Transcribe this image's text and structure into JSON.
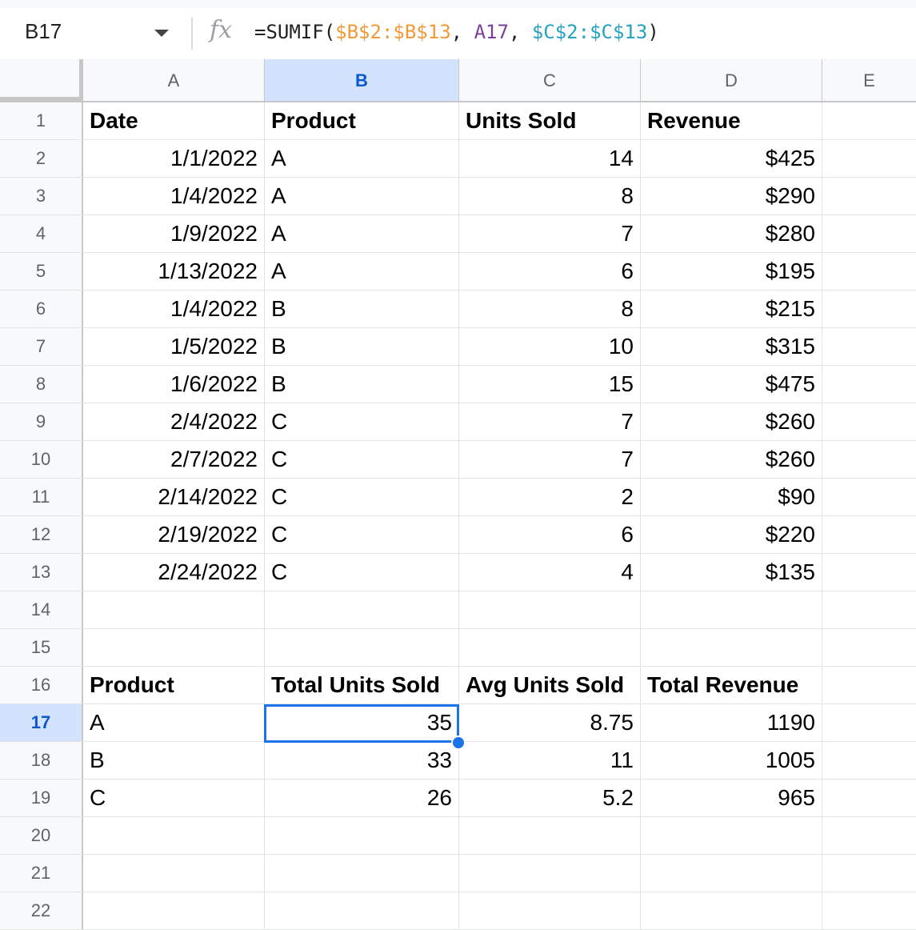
{
  "formula_bar": {
    "name_box": "B17",
    "fx_icon": "fx",
    "formula": [
      {
        "text": "=SUMIF(",
        "color": "#202124"
      },
      {
        "text": "$B$2:$B$13",
        "color": "#f29a38"
      },
      {
        "text": ", ",
        "color": "#202124"
      },
      {
        "text": "A17",
        "color": "#7b3f9e"
      },
      {
        "text": ", ",
        "color": "#202124"
      },
      {
        "text": "$C$2:$C$13",
        "color": "#23a2c2"
      },
      {
        "text": ")",
        "color": "#202124"
      }
    ]
  },
  "columns": [
    "A",
    "B",
    "C",
    "D",
    "E"
  ],
  "selected_column": "B",
  "selected_row": "17",
  "rows": [
    {
      "n": "1",
      "cells": [
        "Date",
        "Product",
        "Units Sold",
        "Revenue"
      ],
      "bold": true
    },
    {
      "n": "2",
      "cells": [
        "1/1/2022",
        "A",
        "14",
        "$425"
      ]
    },
    {
      "n": "3",
      "cells": [
        "1/4/2022",
        "A",
        "8",
        "$290"
      ]
    },
    {
      "n": "4",
      "cells": [
        "1/9/2022",
        "A",
        "7",
        "$280"
      ]
    },
    {
      "n": "5",
      "cells": [
        "1/13/2022",
        "A",
        "6",
        "$195"
      ]
    },
    {
      "n": "6",
      "cells": [
        "1/4/2022",
        "B",
        "8",
        "$215"
      ]
    },
    {
      "n": "7",
      "cells": [
        "1/5/2022",
        "B",
        "10",
        "$315"
      ]
    },
    {
      "n": "8",
      "cells": [
        "1/6/2022",
        "B",
        "15",
        "$475"
      ]
    },
    {
      "n": "9",
      "cells": [
        "2/4/2022",
        "C",
        "7",
        "$260"
      ]
    },
    {
      "n": "10",
      "cells": [
        "2/7/2022",
        "C",
        "7",
        "$260"
      ]
    },
    {
      "n": "11",
      "cells": [
        "2/14/2022",
        "C",
        "2",
        "$90"
      ]
    },
    {
      "n": "12",
      "cells": [
        "2/19/2022",
        "C",
        "6",
        "$220"
      ]
    },
    {
      "n": "13",
      "cells": [
        "2/24/2022",
        "C",
        "4",
        "$135"
      ]
    },
    {
      "n": "14",
      "cells": [
        "",
        "",
        "",
        ""
      ]
    },
    {
      "n": "15",
      "cells": [
        "",
        "",
        "",
        ""
      ]
    },
    {
      "n": "16",
      "cells": [
        "Product",
        "Total Units Sold",
        "Avg Units Sold",
        "Total Revenue"
      ],
      "bold": true
    },
    {
      "n": "17",
      "cells": [
        "A",
        "35",
        "8.75",
        "1190"
      ]
    },
    {
      "n": "18",
      "cells": [
        "B",
        "33",
        "11",
        "1005"
      ]
    },
    {
      "n": "19",
      "cells": [
        "C",
        "26",
        "5.2",
        "965"
      ]
    },
    {
      "n": "20",
      "cells": [
        "",
        "",
        "",
        ""
      ]
    },
    {
      "n": "21",
      "cells": [
        "",
        "",
        "",
        ""
      ]
    },
    {
      "n": "22",
      "cells": [
        "",
        "",
        "",
        ""
      ]
    }
  ]
}
